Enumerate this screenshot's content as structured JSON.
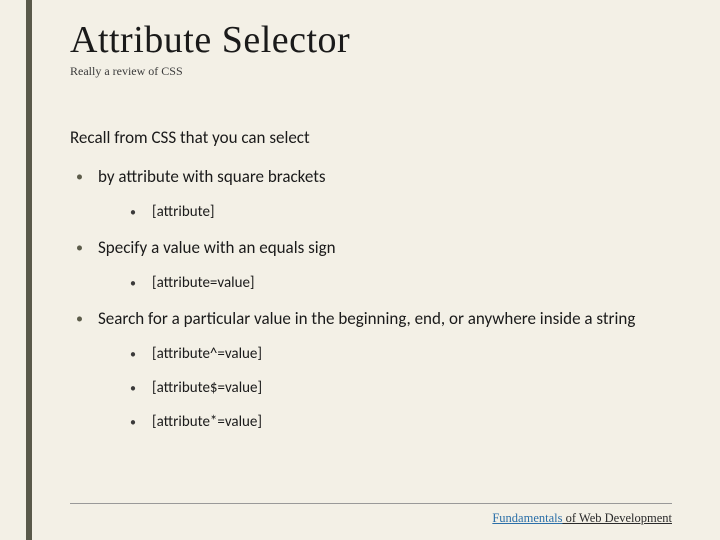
{
  "title": "Attribute Selector",
  "subtitle": "Really a review of CSS",
  "intro": "Recall from CSS that you can select",
  "bullets": [
    {
      "text": "by attribute with square brackets",
      "sub": [
        "[attribute]"
      ]
    },
    {
      "text": "Specify a value with an equals sign",
      "sub": [
        "[attribute=value]"
      ]
    },
    {
      "text": "Search for a particular value in the beginning, end, or anywhere inside a string",
      "sub": [
        "[attribute^=value]",
        "[attribute$=value]",
        "[attribute*=value]"
      ]
    }
  ],
  "footer": {
    "brand": "Fundamentals",
    "rest": " of Web Development"
  }
}
